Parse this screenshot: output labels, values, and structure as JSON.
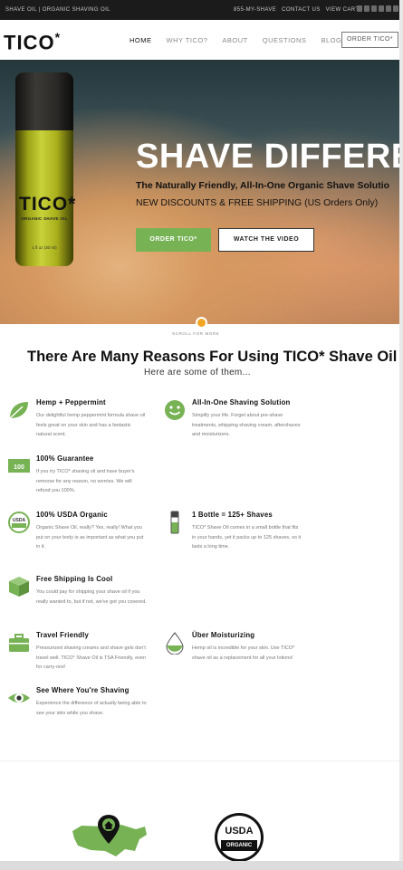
{
  "topbar": {
    "tagline": "SHAVE OIL | ORGANIC SHAVING OIL",
    "links": [
      "855-MY-SHAVE",
      "CONTACT US",
      "VIEW CART"
    ],
    "social_icons": [
      "facebook-icon",
      "twitter-icon",
      "youtube-icon",
      "instagram-icon",
      "pinterest-icon",
      "email-icon"
    ]
  },
  "nav": {
    "logo": "TICO",
    "logo_mark": "*",
    "items": [
      {
        "label": "HOME",
        "active": true
      },
      {
        "label": "WHY TICO?",
        "active": false
      },
      {
        "label": "ABOUT",
        "active": false
      },
      {
        "label": "QUESTIONS",
        "active": false
      },
      {
        "label": "BLOG",
        "active": false
      }
    ],
    "order_button": "ORDER TICO*"
  },
  "hero": {
    "bottle_logo": "TICO*",
    "bottle_subtitle": "ORGANIC SHAVE OIL",
    "bottle_volume": "1 fl oz (30 ml)",
    "title": "SHAVE DIFFERE",
    "subtitle": "The Naturally Friendly, All-In-One Organic Shave Solutio",
    "promo": "NEW DISCOUNTS & FREE SHIPPING (US Orders Only)",
    "primary_button": "ORDER TICO*",
    "secondary_button": "WATCH THE VIDEO",
    "scroll_text": "SCROLL FOR MORE"
  },
  "reasons": {
    "title": "There Are Many Reasons For Using TICO* Shave Oil",
    "subtitle": "Here are some of them...",
    "features": [
      {
        "icon": "leaf-icon",
        "title": "Hemp + Peppermint",
        "text": "Our delightful hemp peppermint formula shave oil feels great on your skin and has a fantastic natural scent."
      },
      {
        "icon": "smiley-icon",
        "title": "All-In-One Shaving Solution",
        "text": "Simplify your life. Forget about pre-shave treatments, whipping shaving cream, aftershaves and moisturizers."
      },
      {
        "icon": "money-icon",
        "title": "100% Guarantee",
        "text": "If you try TICO* shaving oil and have buyer's remorse for any reason, no worries. We will refund you 100%."
      },
      {
        "icon": "usda-organic-icon",
        "title": "100% USDA Organic",
        "text": "Organic Shave Oil, really? Yes, really! What you put on your body is as important as what you put in it."
      },
      {
        "icon": "bottle-icon",
        "title": "1 Bottle = 125+ Shaves",
        "text": "TICO* Shave Oil comes in a small bottle that fits in your hands, yet it packs up to 125 shaves, so it lasts a long time."
      },
      {
        "icon": "box-icon",
        "title": "Free Shipping Is Cool",
        "text": "You could pay for shipping your shave oil if you really wanted to, but if not, we've got you covered."
      },
      {
        "icon": "suitcase-icon",
        "title": "Travel Friendly",
        "text": "Pressurized shaving creams and shave gels don't travel well. TICO* Shave Oil is TSA Friendly, even for carry-ons!"
      },
      {
        "icon": "droplet-icon",
        "title": "Über Moisturizing",
        "text": "Hemp oil is incredible for your skin. Use TICO* shave oil as a replacement for all your lotions!"
      },
      {
        "icon": "eye-icon",
        "title": "See Where You're Shaving",
        "text": "Experience the difference of actually being able to see your skin while you shave."
      }
    ]
  },
  "badges": {
    "usa_map_icon": "usa-home-map-icon",
    "usda_text_top": "USDA",
    "usda_text_bottom": "ORGANIC"
  },
  "colors": {
    "accent_green": "#77b255",
    "scroll_orange": "#f0a623",
    "topbar_bg": "#1b1b1b"
  }
}
